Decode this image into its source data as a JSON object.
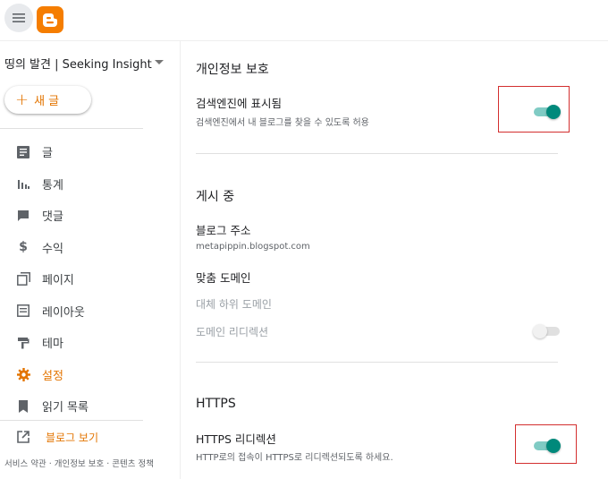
{
  "header": {
    "menu_icon": "hamburger-menu-icon",
    "logo_icon": "blogger-logo-icon",
    "brand_color": "#f57d00"
  },
  "sidebar": {
    "blog_name": "띵의 발견 | Seeking Insight",
    "new_post_label": "새 글",
    "items": [
      {
        "label": "글",
        "icon": "posts-icon"
      },
      {
        "label": "통계",
        "icon": "stats-icon"
      },
      {
        "label": "댓글",
        "icon": "comments-icon"
      },
      {
        "label": "수익",
        "icon": "earnings-icon"
      },
      {
        "label": "페이지",
        "icon": "pages-icon"
      },
      {
        "label": "레이아웃",
        "icon": "layout-icon"
      },
      {
        "label": "테마",
        "icon": "theme-icon"
      },
      {
        "label": "설정",
        "icon": "settings-icon",
        "active": true
      },
      {
        "label": "읽기 목록",
        "icon": "reading-list-icon"
      }
    ],
    "view_blog_label": "블로그 보기",
    "footer_links": "서비스 약관 · 개인정보 보호 · 콘텐츠 정책",
    "accent_color": "#e37400"
  },
  "main": {
    "privacy": {
      "title": "개인정보 보호",
      "search_visible_title": "검색엔진에 표시됨",
      "search_visible_desc": "검색엔진에서 내 블로그를 찾을 수 있도록 허용",
      "search_visible_on": true
    },
    "publishing": {
      "title": "게시 중",
      "blog_address_label": "블로그 주소",
      "blog_address_value": "metapippin.blogspot.com",
      "custom_domain_label": "맞춤 도메인",
      "fallback_subdomain_label": "대체 하위 도메인",
      "domain_redirect_label": "도메인 리디렉션",
      "domain_redirect_on": false
    },
    "https": {
      "title": "HTTPS",
      "redirect_title": "HTTPS 리디렉션",
      "redirect_desc": "HTTP로의 접속이 HTTPS로 리디렉션되도록 하세요.",
      "redirect_on": true
    },
    "toggle_on_color": "#00897b",
    "highlight_color": "#d32f2f"
  }
}
